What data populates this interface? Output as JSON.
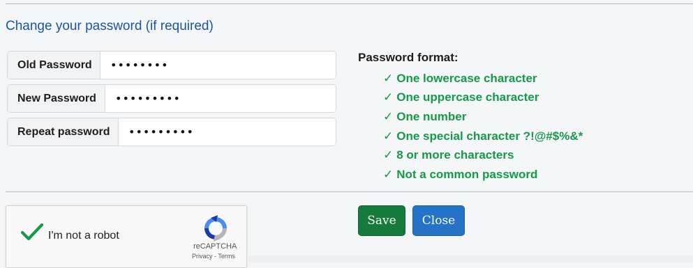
{
  "section": {
    "heading": "Change your password (if required)"
  },
  "form": {
    "old_password": {
      "label": "Old Password",
      "value": "••••••••"
    },
    "new_password": {
      "label": "New Password",
      "value": "•••••••••"
    },
    "repeat_password": {
      "label": "Repeat password",
      "value": "•••••••••"
    }
  },
  "password_format": {
    "title": "Password format:",
    "rules": [
      "One lowercase character",
      "One uppercase character",
      "One number",
      "One special character ?!@#$%&*",
      "8 or more characters",
      "Not a common password"
    ],
    "check_glyph": "✓",
    "color": "#159a49"
  },
  "recaptcha": {
    "label": "I'm not a robot",
    "brand": "reCAPTCHA",
    "links": "Privacy - Terms",
    "checked": true
  },
  "buttons": {
    "save": "Save",
    "close": "Close"
  },
  "colors": {
    "heading": "#1a56a4",
    "save": "#157a3c",
    "close": "#2473c6"
  }
}
